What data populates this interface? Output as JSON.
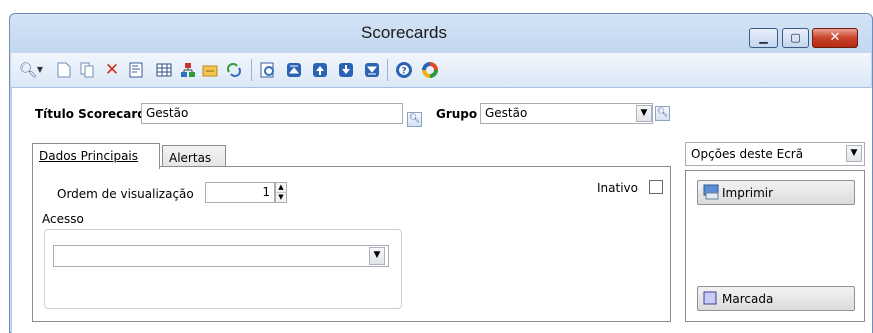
{
  "window": {
    "title": "Scorecards"
  },
  "toolbar": {
    "icons": [
      "search-icon",
      "dropdown-arrow-icon",
      "new-document-icon",
      "copy-document-icon",
      "delete-icon",
      "properties-icon",
      "grid-icon",
      "hierarchy-icon",
      "export-icon",
      "refresh-icon",
      "preview-icon",
      "move-first-icon",
      "move-up-icon",
      "move-down-icon",
      "move-last-icon",
      "help-icon",
      "options-icon"
    ]
  },
  "form": {
    "titulo_label": "Título Scorecard",
    "titulo_value": "Gestão",
    "grupo_label": "Grupo",
    "grupo_value": "Gestão"
  },
  "tabs": [
    {
      "label": "Dados Principais",
      "active": true
    },
    {
      "label": "Alertas",
      "active": false
    }
  ],
  "main": {
    "ordem_label": "Ordem de visualização",
    "ordem_value": "1",
    "inativo_label": "Inativo",
    "inativo_checked": false,
    "acesso_label": "Acesso",
    "acesso_value": ""
  },
  "side": {
    "options_label": "Opções deste Ecrã",
    "imprimir_label": "Imprimir",
    "marcada_label": "Marcada"
  },
  "colors": {
    "title_bg": "#c3d7f1",
    "close_btn": "#c8432a",
    "accent": "#3a5f92"
  }
}
